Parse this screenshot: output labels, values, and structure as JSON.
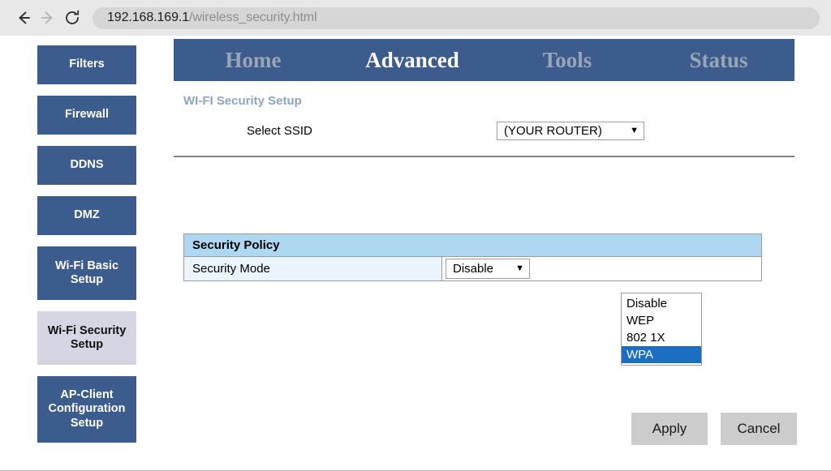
{
  "browser": {
    "back_icon": "back-arrow-icon",
    "forward_icon": "forward-arrow-icon",
    "reload_icon": "reload-icon",
    "url_host": "192.168.169.1",
    "url_path": "/wireless_security.html"
  },
  "sidebar": {
    "items": [
      {
        "label": "Filters",
        "active": false
      },
      {
        "label": "Firewall",
        "active": false
      },
      {
        "label": "DDNS",
        "active": false
      },
      {
        "label": "DMZ",
        "active": false
      },
      {
        "label": "Wi-Fi Basic Setup",
        "active": false
      },
      {
        "label": "Wi-Fi Security Setup",
        "active": true
      },
      {
        "label": "AP-Client Configuration Setup",
        "active": false
      }
    ]
  },
  "navbar": {
    "items": [
      {
        "label": "Home",
        "active": false
      },
      {
        "label": "Advanced",
        "active": true
      },
      {
        "label": "Tools",
        "active": false
      },
      {
        "label": "Status",
        "active": false
      }
    ]
  },
  "main": {
    "section_title": "WI-FI Security Setup",
    "ssid": {
      "label": "Select SSID",
      "value": "(YOUR ROUTER)",
      "caret": "▼"
    },
    "policy": {
      "header": "Security Policy",
      "mode_label": "Security Mode",
      "mode_value": "Disable",
      "mode_caret": "▼",
      "options": [
        {
          "label": "Disable",
          "selected": false
        },
        {
          "label": "WEP",
          "selected": false
        },
        {
          "label": "802 1X",
          "selected": false
        },
        {
          "label": "WPA",
          "selected": true
        }
      ]
    },
    "buttons": {
      "apply": "Apply",
      "cancel": "Cancel"
    }
  },
  "colors": {
    "nav_blue": "#3b5c8c",
    "active_sidebar": "#d5d5e4",
    "table_header": "#aed7f2",
    "table_label_cell": "#e9f4fc",
    "option_highlight": "#1b6ec2",
    "section_title": "#8ba5c4"
  }
}
